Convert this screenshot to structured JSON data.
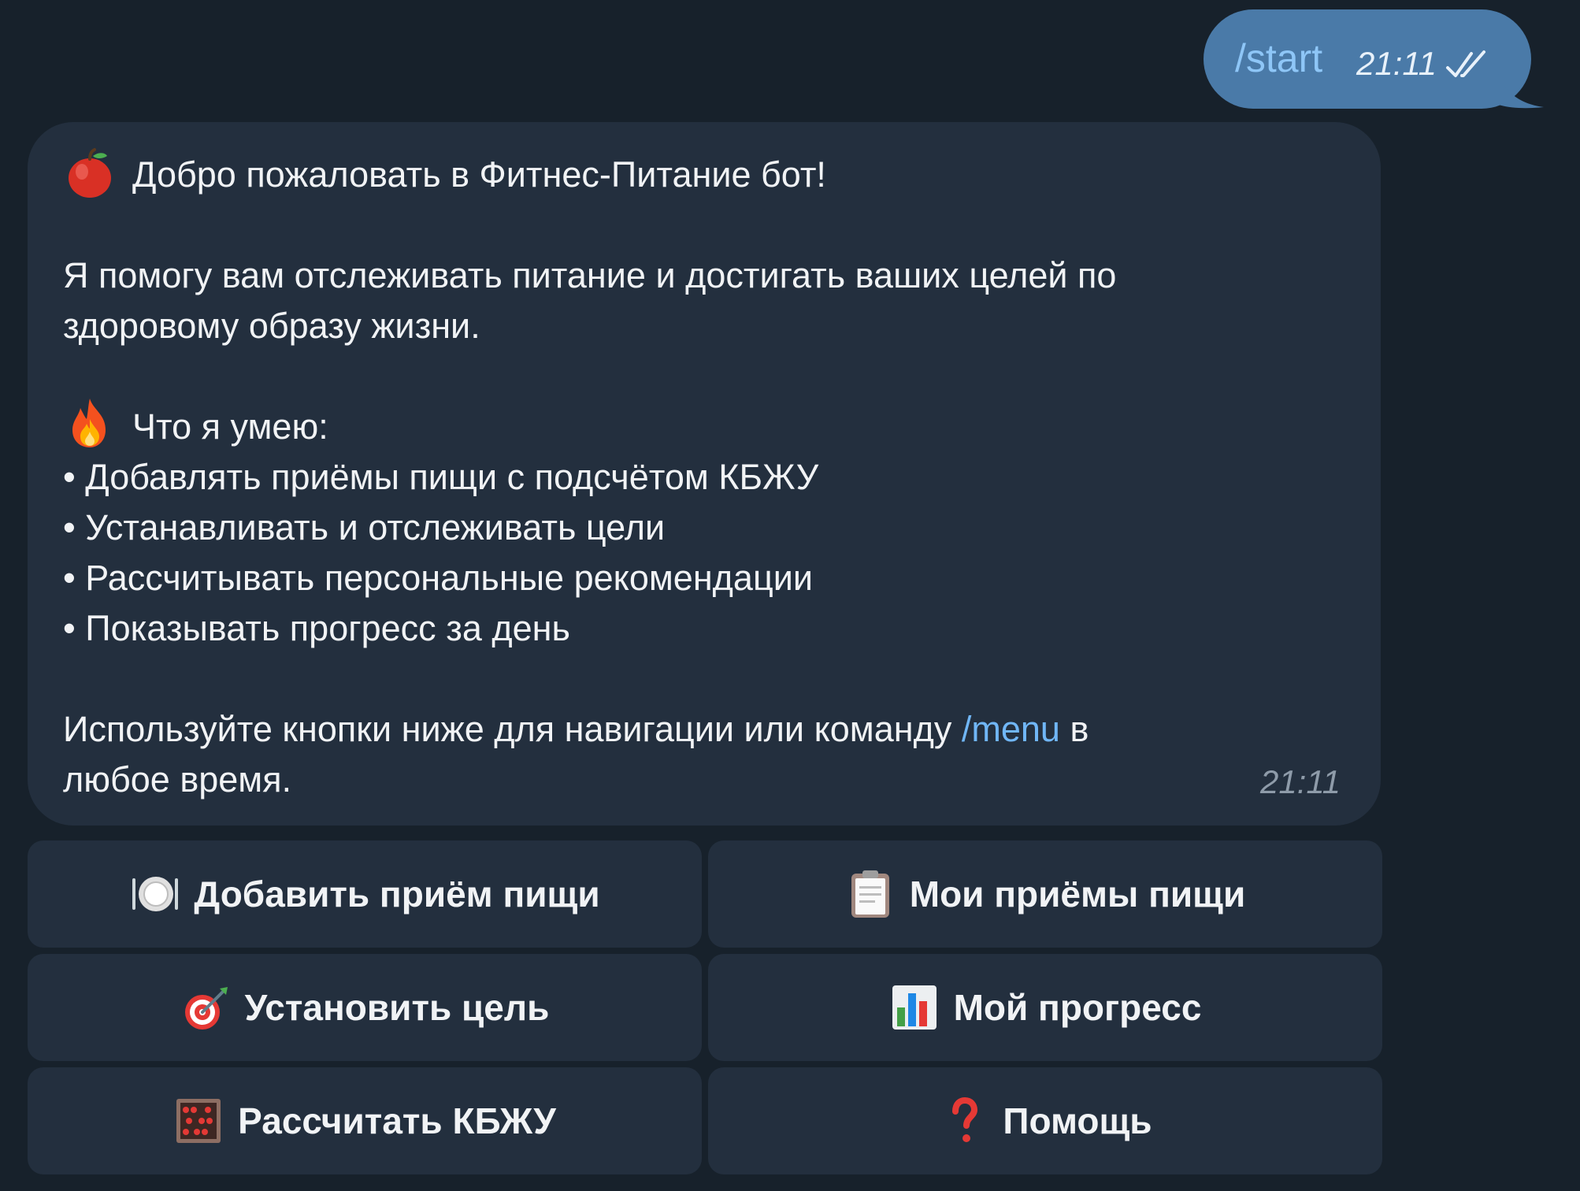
{
  "outgoing": {
    "text": "/start",
    "time": "21:11",
    "status_icon": "double-check-icon"
  },
  "incoming": {
    "welcome": "Добро пожаловать в Фитнес-Питание бот!",
    "welcome_icon": "red-apple-icon",
    "intro_line1": "Я помогу вам отслеживать питание и достигать ваших целей по",
    "intro_line2": "здоровому образу жизни.",
    "features_heading": "Что я умею:",
    "features_icon": "fire-icon",
    "features": [
      "• Добавлять приёмы пищи с подсчётом КБЖУ",
      "• Устанавливать и отслеживать цели",
      "• Рассчитывать персональные рекомендации",
      "• Показывать прогресс за день"
    ],
    "footer_before": "Используйте кнопки ниже для навигации или команду ",
    "footer_link": "/menu",
    "footer_after": " в",
    "footer_line2": "любое время.",
    "time": "21:11"
  },
  "keyboard": {
    "buttons": [
      {
        "label": "Добавить приём пищи",
        "icon": "plate-icon"
      },
      {
        "label": "Мои приёмы пищи",
        "icon": "clipboard-icon"
      },
      {
        "label": "Установить цель",
        "icon": "target-icon"
      },
      {
        "label": "Мой прогресс",
        "icon": "bar-chart-icon"
      },
      {
        "label": "Рассчитать КБЖУ",
        "icon": "abacus-icon"
      },
      {
        "label": "Помощь",
        "icon": "question-mark-icon"
      }
    ]
  },
  "colors": {
    "background": "#17212b",
    "incoming_bubble": "#232f3e",
    "outgoing_bubble": "#4a7aa8",
    "link": "#70b6f6",
    "command_outgoing": "#8ec6f7"
  }
}
